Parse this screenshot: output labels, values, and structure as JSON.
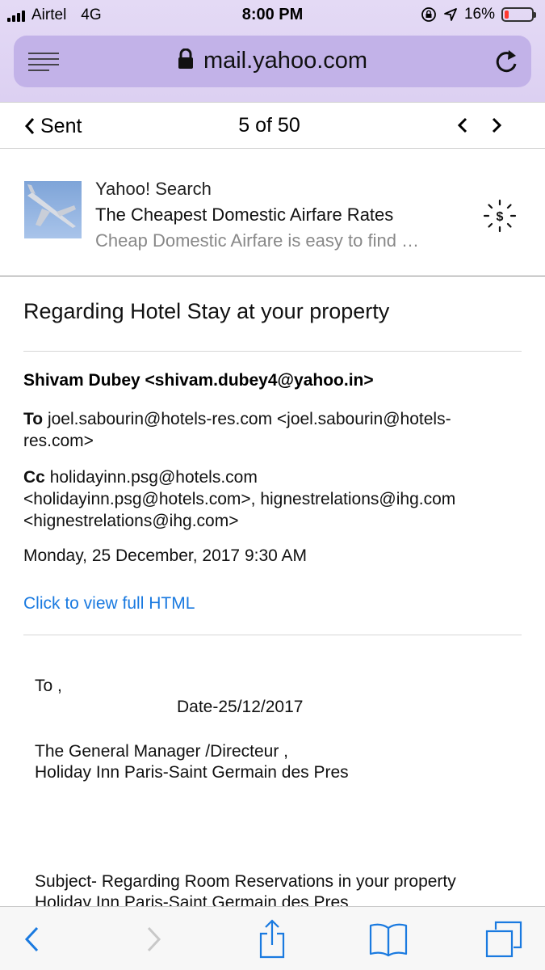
{
  "status_bar": {
    "carrier": "Airtel",
    "network": "4G",
    "time": "8:00 PM",
    "battery": "16%",
    "battery_level": 0.16,
    "icons": [
      "signal-icon",
      "orientation-lock-icon",
      "location-icon",
      "battery-icon"
    ]
  },
  "browser": {
    "url": "mail.yahoo.com",
    "icons": [
      "menu-icon",
      "lock-icon",
      "reload-icon"
    ]
  },
  "mail_nav": {
    "back_label": "Sent",
    "position": "5 of 50"
  },
  "ad": {
    "sponsor": "Yahoo! Search",
    "headline": "The Cheapest Domestic Airfare Rates",
    "description": "Cheap Domestic Airfare is easy to find …",
    "icons": [
      "airplane-thumbnail",
      "sponsored-dollar-icon"
    ]
  },
  "email": {
    "subject": "Regarding Hotel Stay at your property",
    "from": "Shivam Dubey <shivam.dubey4@yahoo.in>",
    "to_label": "To",
    "to_line1": "joel.sabourin@hotels-res.com <joel.sabourin@hotels-",
    "to_line2": "res.com>",
    "cc_label": "Cc",
    "cc_line1": "holidayinn.psg@hotels.com",
    "cc_line2": "<holidayinn.psg@hotels.com>, hignestrelations@ihg.com",
    "cc_line3": "<hignestrelations@ihg.com>",
    "date": "Monday, 25 December, 2017 9:30 AM",
    "full_html_link": "Click to view full HTML"
  },
  "letter": {
    "to": "To ,",
    "date": "Date-25/12/2017",
    "recipient_title": "The General Manager /Directeur ,",
    "recipient_hotel": "Holiday Inn Paris-Saint Germain des Pres",
    "subject_line1": "Subject- Regarding Room Reservations in your property",
    "subject_line2": "Holiday Inn Paris-Saint Germain des Pres"
  },
  "toolbar": {
    "icons": [
      "back-arrow-icon",
      "forward-arrow-icon",
      "share-icon",
      "bookmarks-icon",
      "tabs-icon"
    ]
  }
}
